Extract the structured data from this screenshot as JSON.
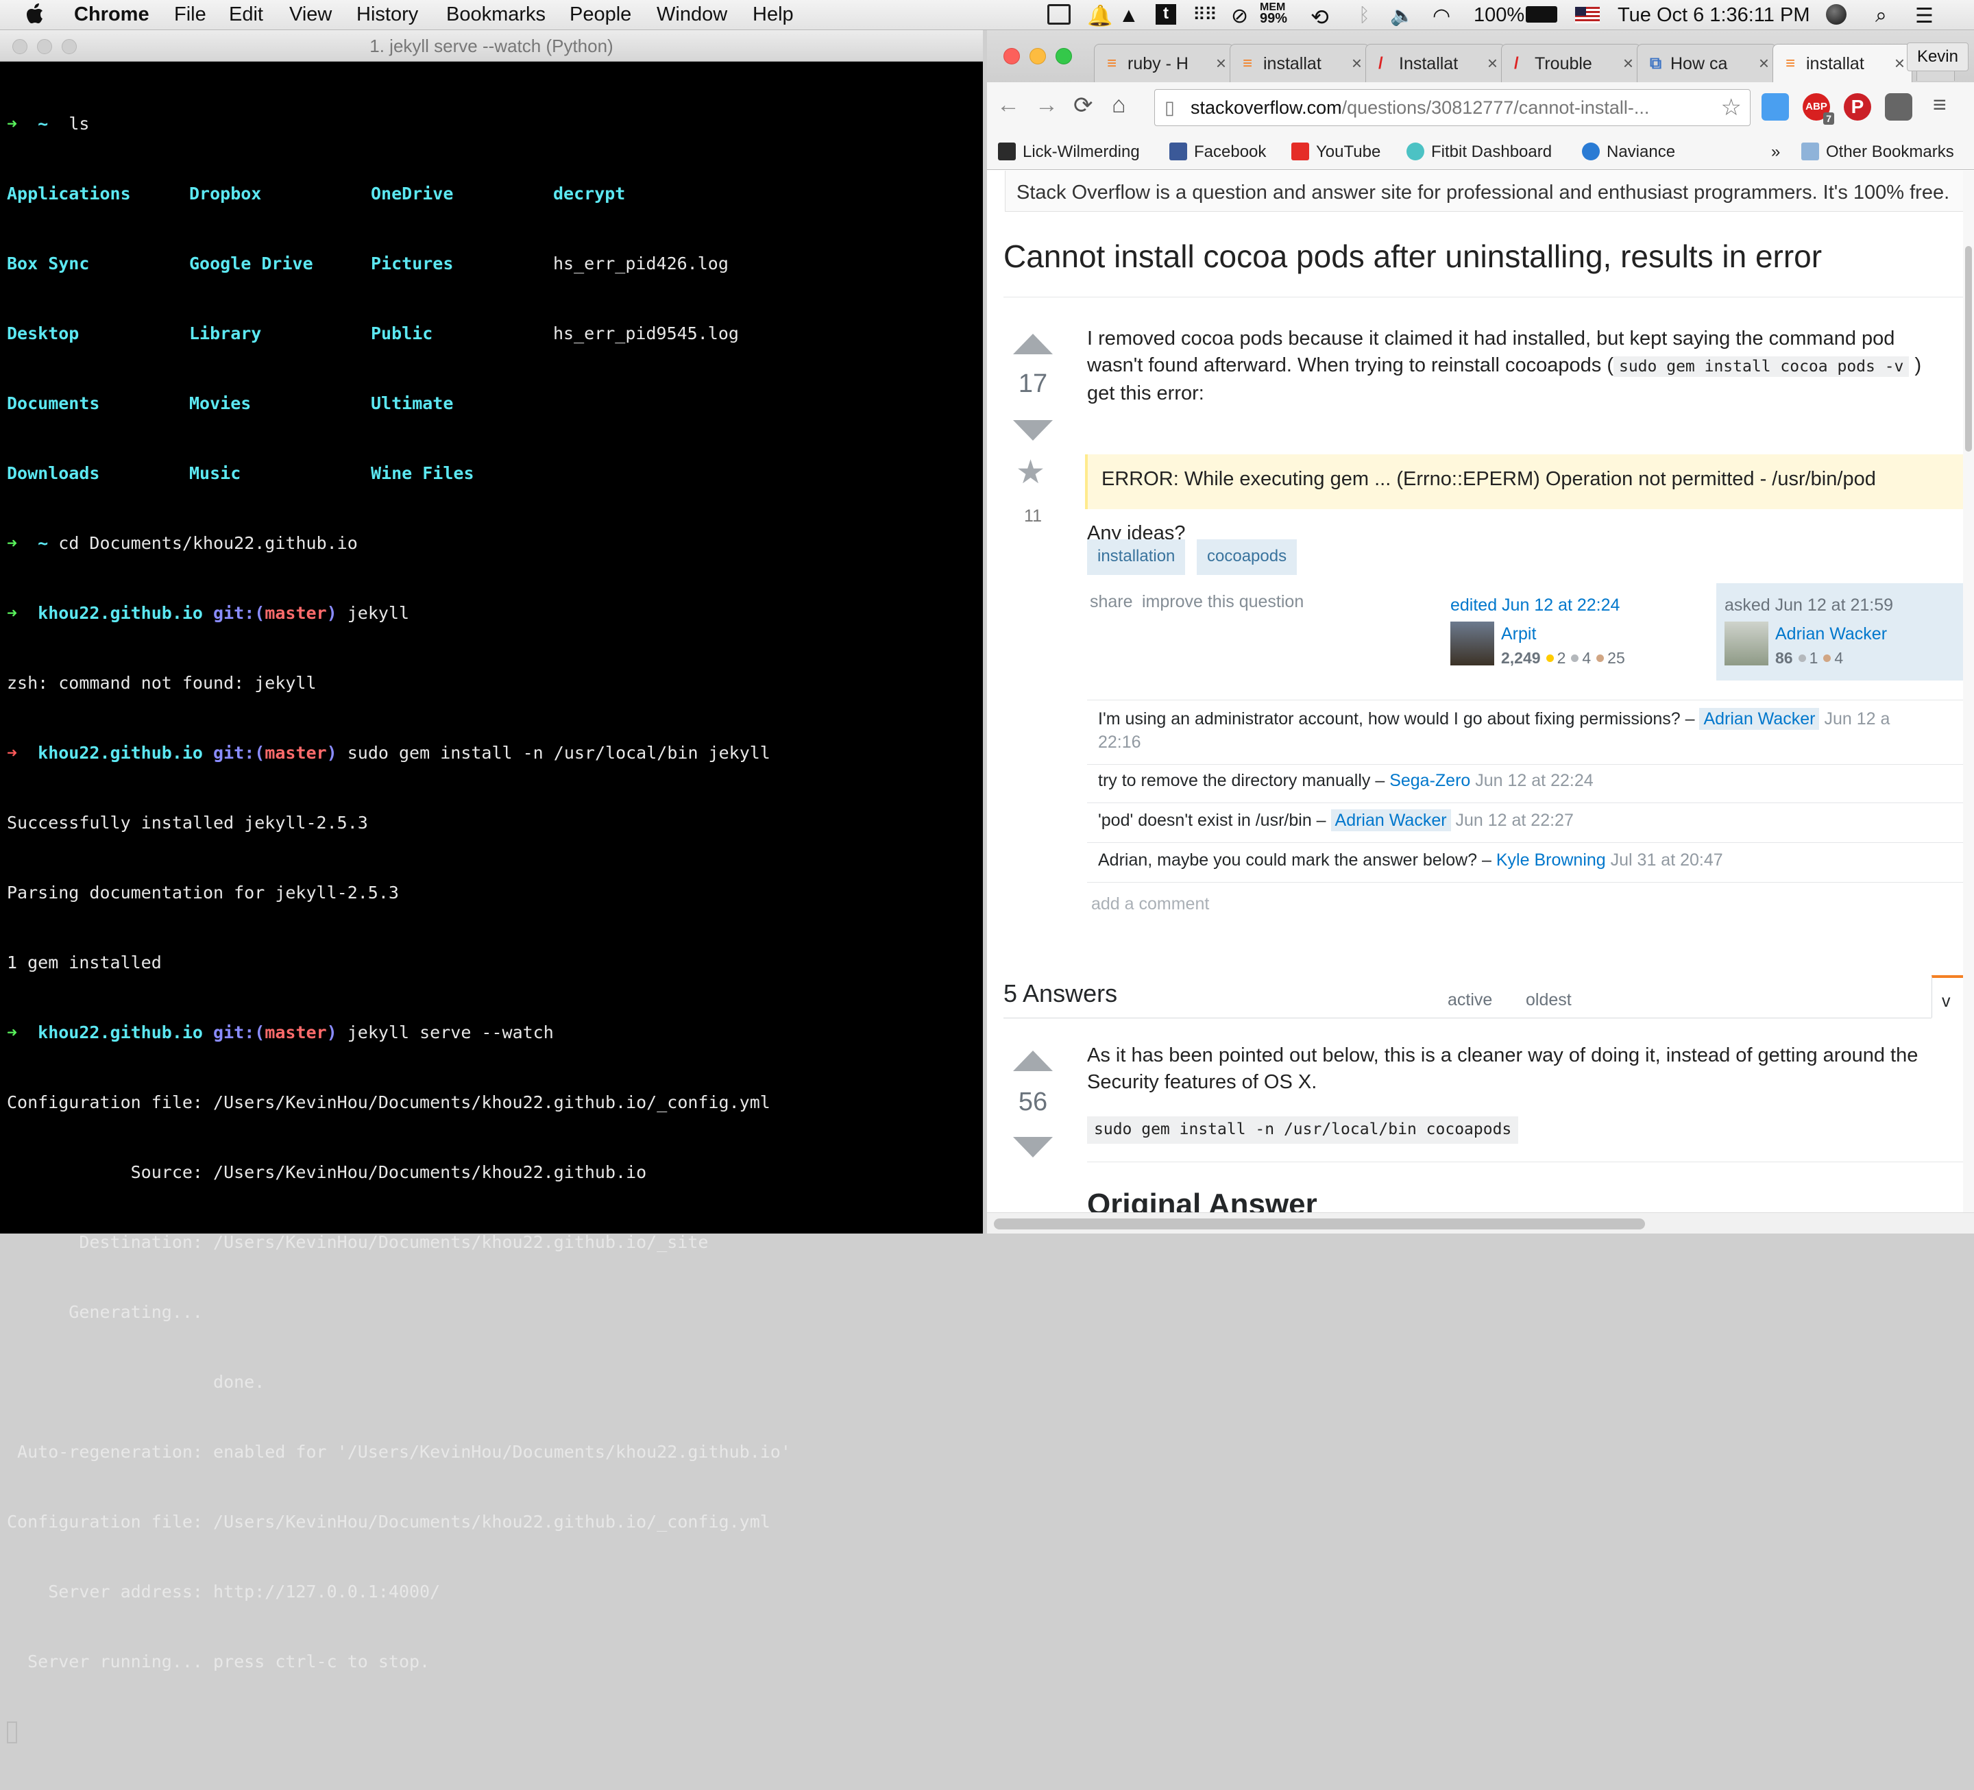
{
  "menubar": {
    "app_name": "Chrome",
    "menus": [
      "File",
      "Edit",
      "View",
      "History",
      "Bookmarks",
      "People",
      "Window",
      "Help"
    ],
    "mem_label": "MEM",
    "mem_value": "99%",
    "battery": "100%",
    "clock": "Tue Oct 6  1:36:11 PM"
  },
  "terminal": {
    "title": "1. jekyll serve --watch (Python)",
    "ls_cmd": "ls",
    "ls_items": [
      [
        "Applications",
        "Dropbox",
        "OneDrive",
        "decrypt"
      ],
      [
        "Box Sync",
        "Google Drive",
        "Pictures",
        "hs_err_pid426.log"
      ],
      [
        "Desktop",
        "Library",
        "Public",
        "hs_err_pid9545.log"
      ],
      [
        "Documents",
        "Movies",
        "Ultimate",
        ""
      ],
      [
        "Downloads",
        "Music",
        "Wine Files",
        ""
      ]
    ],
    "prompt_home": "~",
    "cd_cmd": "cd Documents/khou22.github.io",
    "repo": "khou22.github.io",
    "git_label": "git:(",
    "branch": "master",
    "git_close": ")",
    "cmd_jekyll": "jekyll",
    "not_found": "zsh: command not found: jekyll",
    "cmd_install": "sudo gem install -n /usr/local/bin jekyll",
    "out_installed": "Successfully installed jekyll-2.5.3",
    "out_parsing": "Parsing documentation for jekyll-2.5.3",
    "out_count": "1 gem installed",
    "cmd_serve": "jekyll serve --watch",
    "serve_output": [
      "Configuration file: /Users/KevinHou/Documents/khou22.github.io/_config.yml",
      "            Source: /Users/KevinHou/Documents/khou22.github.io",
      "       Destination: /Users/KevinHou/Documents/khou22.github.io/_site",
      "      Generating...",
      "                    done.",
      " Auto-regeneration: enabled for '/Users/KevinHou/Documents/khou22.github.io'",
      "Configuration file: /Users/KevinHou/Documents/khou22.github.io/_config.yml",
      "    Server address: http://127.0.0.1:4000/",
      "  Server running... press ctrl-c to stop."
    ]
  },
  "browser": {
    "tabs": [
      {
        "label": "ruby - H",
        "icon": "stackoverflow"
      },
      {
        "label": "installat",
        "icon": "stackoverflow"
      },
      {
        "label": "Installat",
        "icon": "red-slash"
      },
      {
        "label": "Trouble",
        "icon": "red-slash"
      },
      {
        "label": "How ca",
        "icon": "window"
      },
      {
        "label": "installat",
        "icon": "stackoverflow"
      }
    ],
    "profile": "Kevin",
    "url_domain": "stackoverflow.com",
    "url_path": "/questions/30812777/cannot-install-...",
    "abp_count": "7",
    "bookmarks": [
      {
        "label": "Lick-Wilmerding",
        "color": "#2b2b2b"
      },
      {
        "label": "Facebook",
        "color": "#3b5998"
      },
      {
        "label": "YouTube",
        "color": "#e52d27"
      },
      {
        "label": "Fitbit Dashboard",
        "color": "#4cc2c4"
      },
      {
        "label": "Naviance",
        "color": "#2a7bd4"
      }
    ],
    "more_bookmarks": "»",
    "other_bookmarks": "Other Bookmarks"
  },
  "page": {
    "banner": "Stack Overflow is a question and answer site for professional and enthusiast programmers. It's 100% free.",
    "title": "Cannot install cocoa pods after uninstalling, results in error",
    "q_votes": "17",
    "q_favorites": "11",
    "q_body_1": "I removed cocoa pods because it claimed it had installed, but kept saying the command pod",
    "q_body_2a": "wasn't found afterward. When trying to reinstall cocoapods (",
    "q_body_code": "sudo gem install cocoa pods -v",
    "q_body_2b": ")",
    "q_body_3": "get this error:",
    "blockquote": "ERROR: While executing gem ... (Errno::EPERM) Operation not permitted - /usr/bin/pod",
    "q_body_4": "Any ideas?",
    "tags": [
      "installation",
      "cocoapods"
    ],
    "share": "share",
    "improve": "improve this question",
    "edited": "edited Jun 12 at 22:24",
    "editor_name": "Arpit",
    "editor_rep": "2,249",
    "editor_gold": "2",
    "editor_silver": "4",
    "editor_bronze": "25",
    "asked": "asked Jun 12 at 21:59",
    "asker_name": "Adrian Wacker",
    "asker_rep": "86",
    "asker_silver": "1",
    "asker_bronze": "4",
    "comments": [
      {
        "text": "I'm using an administrator account, how would I go about fixing permissions? –",
        "user": "Adrian Wacker",
        "date": "Jun 12 a",
        "date2": "22:16",
        "op": true
      },
      {
        "text": "try to remove the directory manually –",
        "user": "Sega-Zero",
        "date": "Jun 12 at 22:24",
        "op": false
      },
      {
        "text": "'pod' doesn't exist in /usr/bin –",
        "user": "Adrian Wacker",
        "date": "Jun 12 at 22:27",
        "op": true
      },
      {
        "text": "Adrian, maybe you could mark the answer below? –",
        "user": "Kyle Browning",
        "date": "Jul 31 at 20:47",
        "op": false
      }
    ],
    "add_comment": "add a comment",
    "answers_header": "5 Answers",
    "sort_tabs": [
      "active",
      "oldest",
      "v"
    ],
    "a_votes": "56",
    "a_body_1": "As it has been pointed out below, this is a cleaner way of doing it, instead of getting around the",
    "a_body_2": "Security features of OS X.",
    "a_code": "sudo gem install -n /usr/local/bin cocoapods",
    "a_heading": "Original Answer"
  }
}
